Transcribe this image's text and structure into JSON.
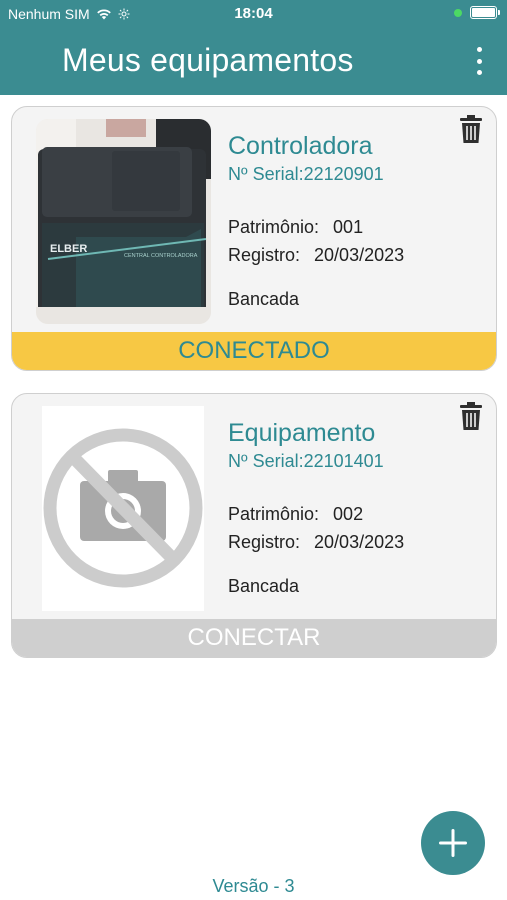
{
  "status_bar": {
    "carrier": "Nenhum SIM",
    "time": "18:04",
    "battery_level": 1.0,
    "charging_color": "#4cd964"
  },
  "header": {
    "title": "Meus equipamentos",
    "menu_icon": "more-vertical-icon",
    "background_color": "#3b8c91"
  },
  "devices": [
    {
      "name": "Controladora",
      "serial": "Nº Serial:22120901",
      "patrimonio_label": "Patrimônio:",
      "patrimonio_value": "001",
      "registro_label": "Registro:",
      "registro_value": "20/03/2023",
      "location": "Bancada",
      "status_label": "CONECTADO",
      "status_color": "#f7c844",
      "image": "device-photo",
      "photo_brand_text": "ELBER",
      "photo_model_text": "CENTRAL CONTROLADORA"
    },
    {
      "name": "Equipamento",
      "serial": "Nº Serial:22101401",
      "patrimonio_label": "Patrimônio:",
      "patrimonio_value": "002",
      "registro_label": "Registro:",
      "registro_value": "20/03/2023",
      "location": "Bancada",
      "status_label": "CONECTAR",
      "status_color": "#cfcfcf",
      "image": "no-photo-icon"
    }
  ],
  "fab": {
    "icon": "plus-icon"
  },
  "footer": {
    "version": "Versão - 3"
  },
  "colors": {
    "accent": "#3b8c91",
    "text_accent": "#2e8a92"
  }
}
